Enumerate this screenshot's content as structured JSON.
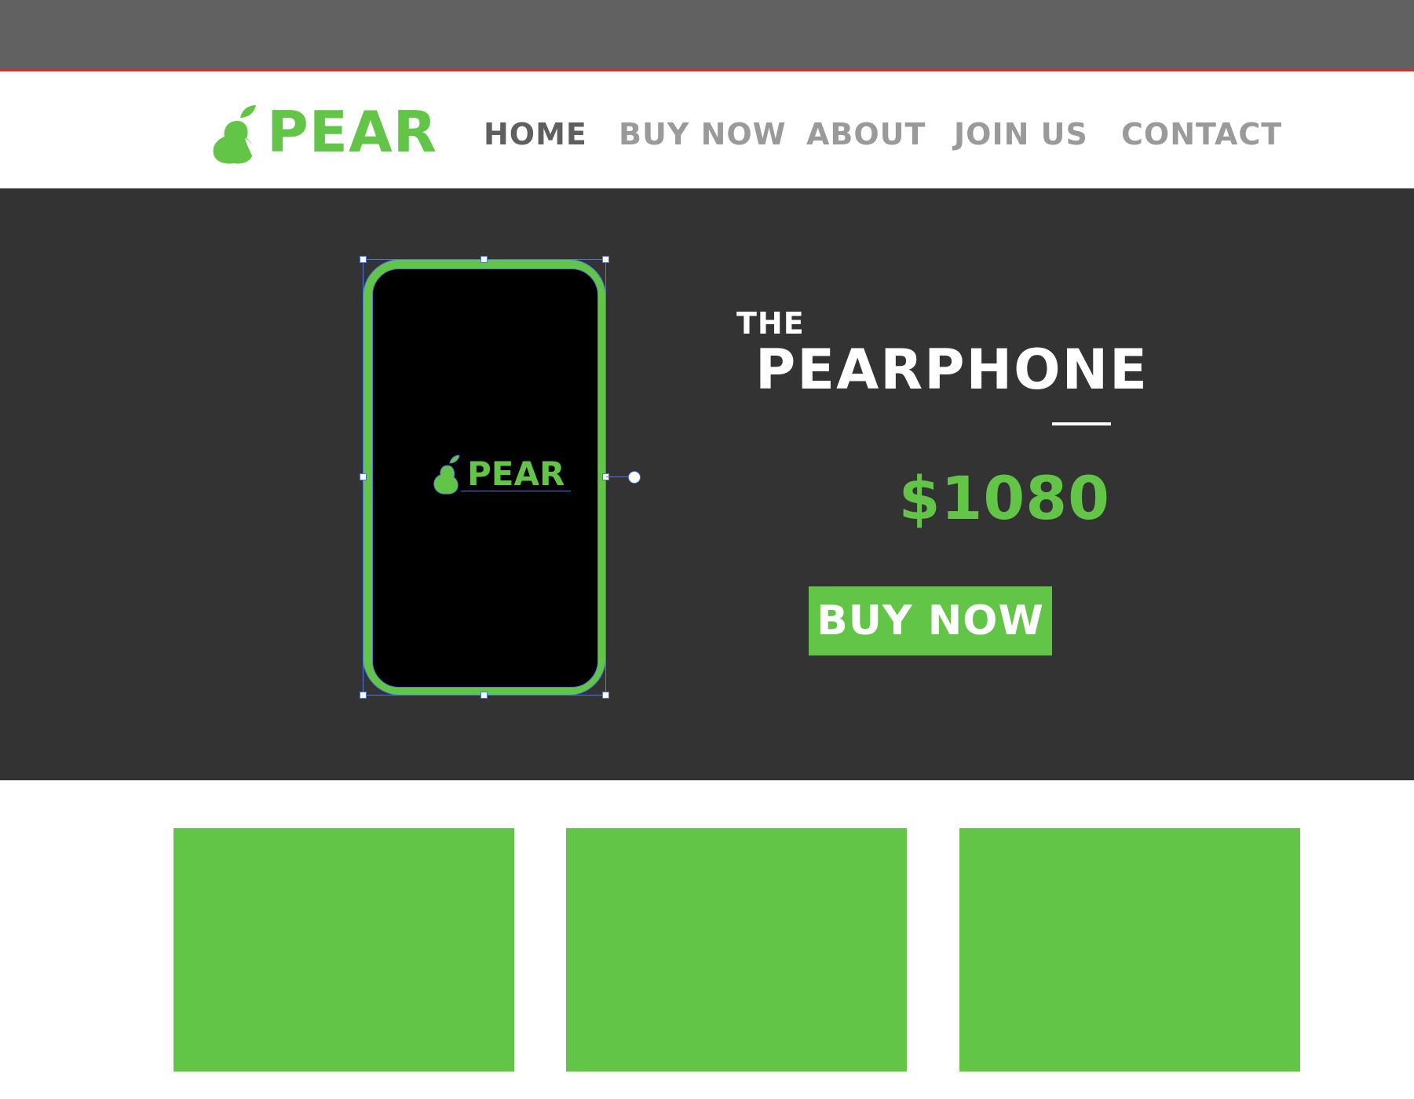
{
  "brand": {
    "name": "PEAR",
    "accent_color": "#63c547",
    "logo_icon": "pear-icon"
  },
  "nav": {
    "items": [
      {
        "label": "HOME",
        "active": true
      },
      {
        "label": "BUY NOW",
        "active": false
      },
      {
        "label": "ABOUT",
        "active": false
      },
      {
        "label": "JOIN US",
        "active": false
      },
      {
        "label": "CONTACT",
        "active": false
      }
    ]
  },
  "hero": {
    "eyebrow": "THE",
    "product_name": "PEARPHONE",
    "price": "$1080",
    "cta_label": "BUY NOW",
    "phone_screen_logo": "PEAR",
    "background_color": "#333333"
  },
  "editor": {
    "selection_color": "#4a78e0"
  },
  "cards": {
    "count": 3,
    "color": "#63c547"
  }
}
